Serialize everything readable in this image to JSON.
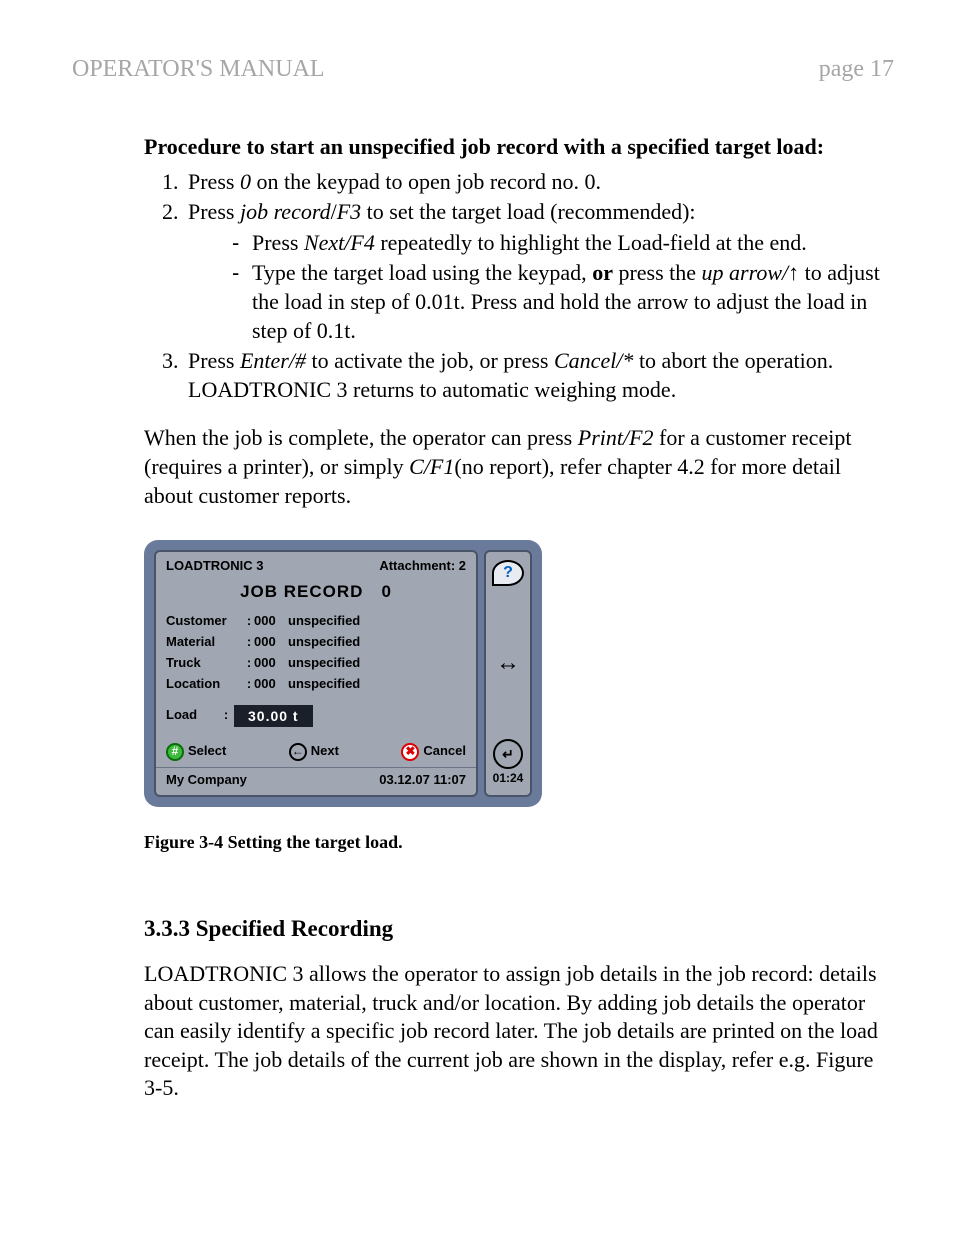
{
  "header": {
    "left": "OPERATOR'S MANUAL",
    "right": "page 17"
  },
  "procedure": {
    "title": "Procedure to start an unspecified job record with a specified target load:",
    "step1_a": "Press ",
    "step1_key": "0",
    "step1_b": " on the keypad to open job record no. 0.",
    "step2_a": "Press ",
    "step2_key1": "job record",
    "step2_slash": "/",
    "step2_key2": "F3",
    "step2_b": " to set the target load (recommended):",
    "sub1_a": "Press ",
    "sub1_key": "Next/F4",
    "sub1_b": " repeatedly to highlight the Load-field at the end.",
    "sub2_a": "Type the target load using the keypad, ",
    "sub2_or": "or",
    "sub2_b": " press the ",
    "sub2_key": "up arrow/",
    "sub2_c": " to adjust the load in step of 0.01t. Press and hold the arrow to adjust the load in step of 0.1t.",
    "step3_a": "Press ",
    "step3_key1": "Enter/#",
    "step3_b": " to activate the job, or press ",
    "step3_key2": "Cancel/*",
    "step3_c": " to abort the operation. LOADTRONIC 3 returns to automatic weighing mode."
  },
  "post": {
    "a": "When the job is complete, the operator can press ",
    "k1": "Print/F2",
    "b": " for a customer receipt (requires a printer), or simply ",
    "k2": "C/F1",
    "c": "(no report), refer chapter 4.2 for more detail about customer reports."
  },
  "device": {
    "brand": "LOADTRONIC 3",
    "attach": "Attachment: 2",
    "title": "JOB RECORD",
    "title_no": "0",
    "fields": [
      {
        "lbl": "Customer",
        "code": "000",
        "val": "unspecified"
      },
      {
        "lbl": "Material",
        "code": "000",
        "val": "unspecified"
      },
      {
        "lbl": "Truck",
        "code": "000",
        "val": "unspecified"
      },
      {
        "lbl": "Location",
        "code": "000",
        "val": "unspecified"
      }
    ],
    "load_lbl": "Load",
    "load_val": "30.00 t",
    "btn_select": "Select",
    "btn_next": "Next",
    "btn_cancel": "Cancel",
    "company": "My Company",
    "datetime": "03.12.07 11:07",
    "clock": "01:24"
  },
  "caption": "Figure 3-4 Setting the target load.",
  "section": {
    "head": "3.3.3 Specified Recording",
    "body": "LOADTRONIC 3 allows the operator to assign job details in the job record: details about customer, material, truck and/or location. By adding job details the operator can easily identify a specific job record later. The job details are printed on the load receipt. The job details of the current job are shown in the display, refer e.g. Figure 3-5."
  }
}
